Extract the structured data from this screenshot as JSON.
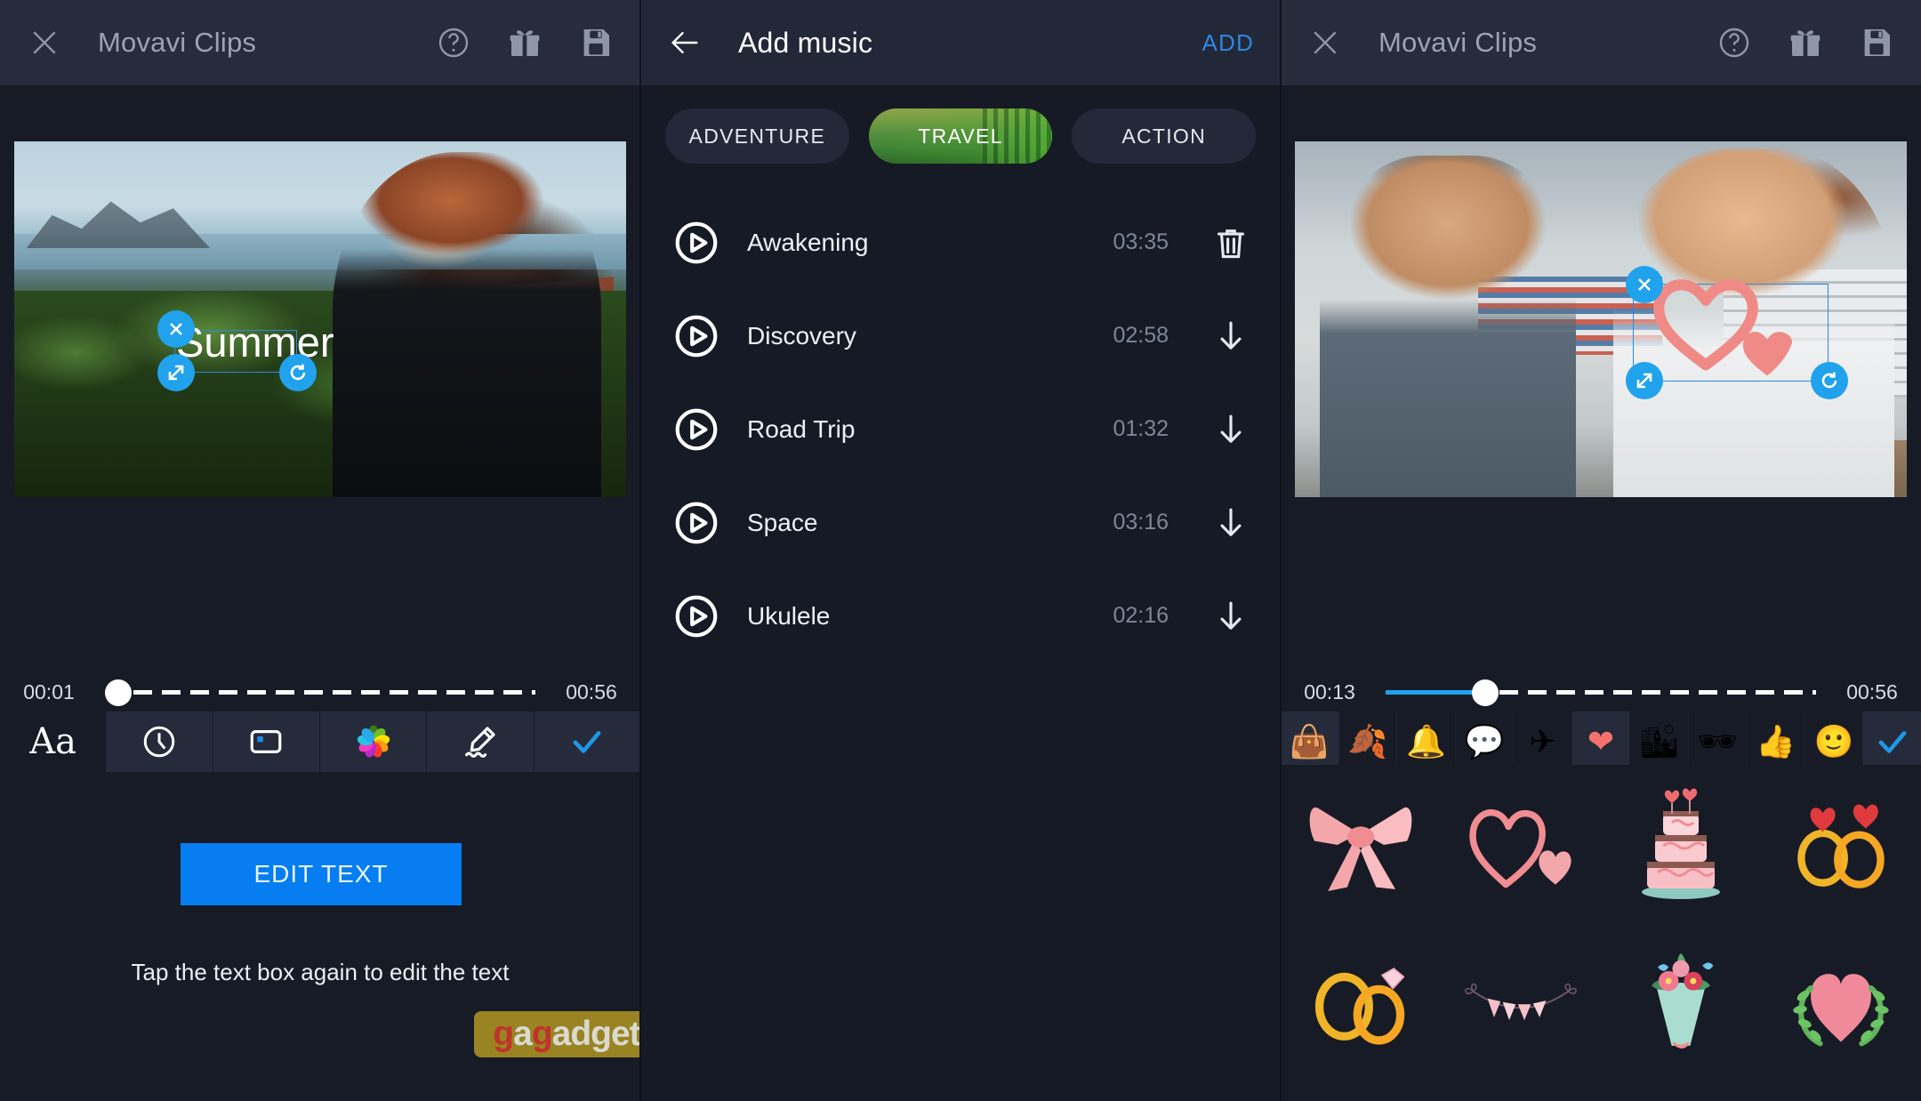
{
  "left_panel": {
    "appbar": {
      "close_icon": "close-icon",
      "title": "Movavi Clips",
      "icons": [
        "help-icon",
        "gift-icon",
        "save-icon"
      ]
    },
    "preview": {
      "overlay_text": "Summer",
      "handles": [
        "delete-handle",
        "resize-handle",
        "rotate-handle"
      ]
    },
    "timeline": {
      "current": "00:01",
      "total": "00:56",
      "progress_percent": 2
    },
    "toolbar": [
      {
        "name": "font-tool",
        "glyph": "Aa"
      },
      {
        "name": "duration-tool",
        "glyph": "clock"
      },
      {
        "name": "background-tool",
        "glyph": "frame"
      },
      {
        "name": "color-tool",
        "glyph": "color-wheel"
      },
      {
        "name": "style-tool",
        "glyph": "pencil"
      },
      {
        "name": "confirm-tool",
        "glyph": "check"
      }
    ],
    "cta": {
      "label": "EDIT TEXT",
      "hint": "Tap the text box again to edit the text"
    },
    "watermark": {
      "prefix": "g",
      "mid": "a",
      "prefix2": "g",
      "suffix": "adget.com"
    }
  },
  "mid_panel": {
    "appbar": {
      "back_icon": "back-arrow-icon",
      "title": "Add music",
      "action_label": "ADD"
    },
    "categories": [
      {
        "label": "ADVENTURE",
        "active": false
      },
      {
        "label": "TRAVEL",
        "active": true
      },
      {
        "label": "ACTION",
        "active": false
      }
    ],
    "tracks": [
      {
        "name": "Awakening",
        "duration": "03:35",
        "action": "delete"
      },
      {
        "name": "Discovery",
        "duration": "02:58",
        "action": "download"
      },
      {
        "name": "Road Trip",
        "duration": "01:32",
        "action": "download"
      },
      {
        "name": "Space",
        "duration": "03:16",
        "action": "download"
      },
      {
        "name": "Ukulele",
        "duration": "02:16",
        "action": "download"
      }
    ]
  },
  "right_panel": {
    "appbar": {
      "close_icon": "close-icon",
      "title": "Movavi Clips",
      "icons": [
        "help-icon",
        "gift-icon",
        "save-icon"
      ]
    },
    "preview": {
      "sticker": "pink-heart-sticker",
      "handles": [
        "delete-handle",
        "resize-handle",
        "rotate-handle"
      ]
    },
    "timeline": {
      "current": "00:13",
      "total": "00:56",
      "progress_percent": 22
    },
    "sticker_categories": [
      {
        "name": "shopping-bag-icon",
        "glyph": "👜"
      },
      {
        "name": "autumn-leaves-icon",
        "glyph": "🍂"
      },
      {
        "name": "school-bells-icon",
        "glyph": "🔔"
      },
      {
        "name": "hello-bubble-icon",
        "glyph": "💬"
      },
      {
        "name": "airplane-icon",
        "glyph": "✈"
      },
      {
        "name": "heart-icon",
        "glyph": "❤",
        "active": true
      },
      {
        "name": "city-buildings-icon",
        "glyph": "🏙"
      },
      {
        "name": "glasses-mustache-icon",
        "glyph": "🕶"
      },
      {
        "name": "thumbs-up-icon",
        "glyph": "👍"
      },
      {
        "name": "smiley-icon",
        "glyph": "🙂"
      },
      {
        "name": "confirm-stickers-icon",
        "glyph": "check"
      }
    ],
    "stickers": [
      {
        "name": "pink-bow-sticker"
      },
      {
        "name": "heart-outline-sticker"
      },
      {
        "name": "wedding-cake-sticker"
      },
      {
        "name": "heart-rings-sticker"
      },
      {
        "name": "diamond-rings-sticker"
      },
      {
        "name": "bunting-flags-sticker"
      },
      {
        "name": "flower-bouquet-sticker"
      },
      {
        "name": "heart-laurel-sticker"
      }
    ]
  },
  "colors": {
    "accent_blue": "#21a2ec",
    "cta_blue": "#067ef2",
    "bg_dark": "#171b26",
    "bar_dark": "#262c3b",
    "tool_cell": "#252b3a",
    "muted_text": "#7e8697",
    "watermark_bg": "#9a8322"
  }
}
